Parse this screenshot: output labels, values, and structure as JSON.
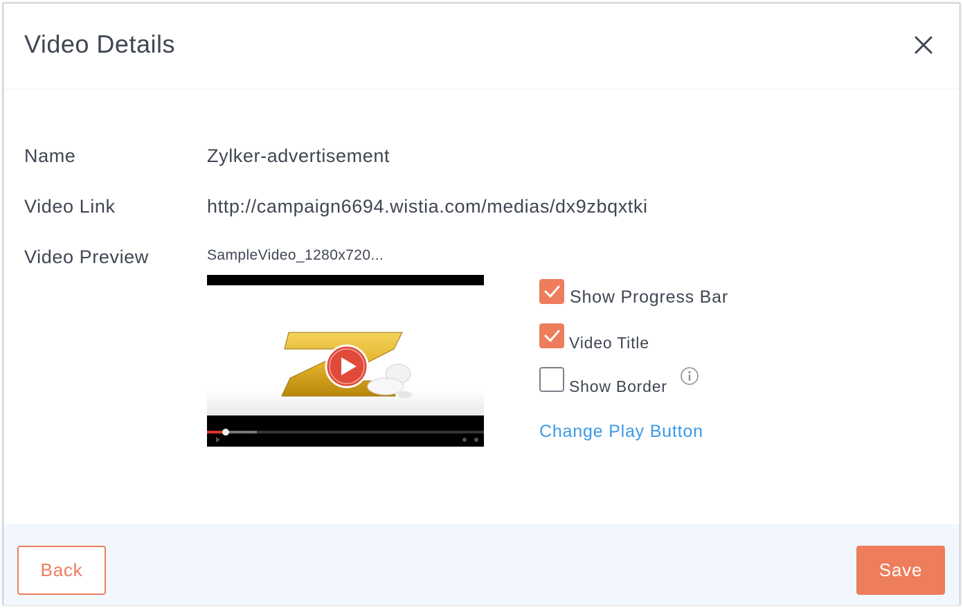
{
  "dialog": {
    "title": "Video Details",
    "close_icon": "close-icon"
  },
  "details": {
    "name_label": "Name",
    "name_value": "Zylker-advertisement",
    "link_label": "Video Link",
    "link_value": "http://campaign6694.wistia.com/medias/dx9zbqxtki",
    "preview_label": "Video Preview",
    "preview_filename": "SampleVideo_1280x720...",
    "play_icon": "play-icon"
  },
  "options": [
    {
      "label": "Show Progress Bar",
      "checked": true
    },
    {
      "label": "Video Title",
      "checked": true
    },
    {
      "label": "Show Border",
      "checked": false
    }
  ],
  "info_icon": "info-icon",
  "change_play_button": "Change Play Button",
  "footer": {
    "back_label": "Back",
    "save_label": "Save"
  },
  "colors": {
    "accent": "#ee7d5c",
    "link": "#3d9ae6",
    "footer_bg": "#f1f7fd",
    "text": "#3f4652"
  }
}
